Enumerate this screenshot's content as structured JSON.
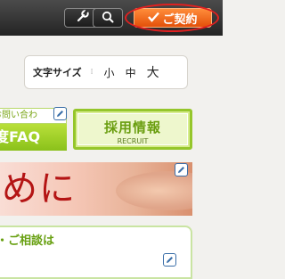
{
  "topbar": {
    "tools_icon": "wrench-icon",
    "search_icon": "search-icon",
    "contract_label": "ご契約",
    "contract_icon": "checkmark-icon",
    "accent_color": "#e3500a"
  },
  "font_size": {
    "label": "文字サイズ",
    "options": [
      "小",
      "中",
      "大"
    ]
  },
  "contact": {
    "top_text": "お問い合わ",
    "bottom_text": "度FAQ"
  },
  "recruit": {
    "title": "採用情報",
    "subtitle": "RECRUIT"
  },
  "hero": {
    "text": "めに"
  },
  "consult": {
    "text": "・ご相談は"
  },
  "edit_icon": "pencil-icon"
}
